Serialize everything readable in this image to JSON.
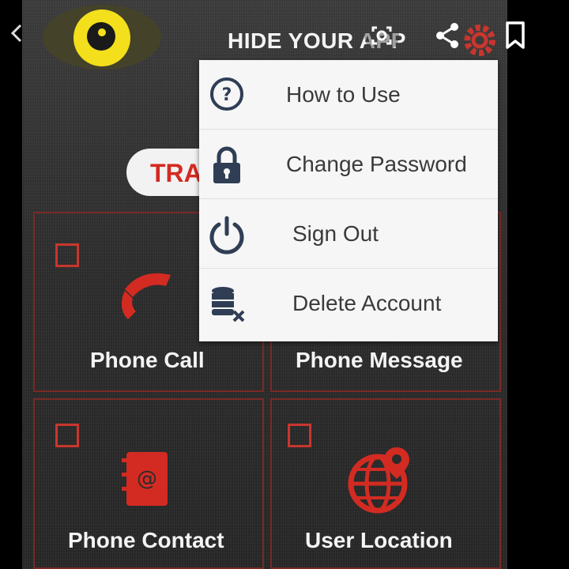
{
  "app": {
    "title": "HIDE YOUR APP",
    "track_button_text": "TRA"
  },
  "top_icons": [
    "back-icon",
    "lens-icon",
    "share-icon",
    "settings-gear-icon",
    "bookmark-icon"
  ],
  "menu": {
    "items": [
      {
        "label": "How to Use",
        "icon": "help-circle-icon"
      },
      {
        "label": "Change Password",
        "icon": "lock-icon"
      },
      {
        "label": "Sign Out",
        "icon": "power-icon"
      },
      {
        "label": "Delete Account",
        "icon": "database-delete-icon"
      }
    ]
  },
  "tiles": [
    {
      "label": "Phone Call",
      "icon": "phone-icon"
    },
    {
      "label": "Phone Message",
      "icon": "message-icon"
    },
    {
      "label": "Phone Contact",
      "icon": "contact-book-icon"
    },
    {
      "label": "User Location",
      "icon": "globe-location-icon"
    }
  ],
  "colors": {
    "accent_red": "#d32b22",
    "eye_yellow": "#f3df1b",
    "menu_bg": "#f6f6f6",
    "menu_icon": "#2f3e55"
  }
}
